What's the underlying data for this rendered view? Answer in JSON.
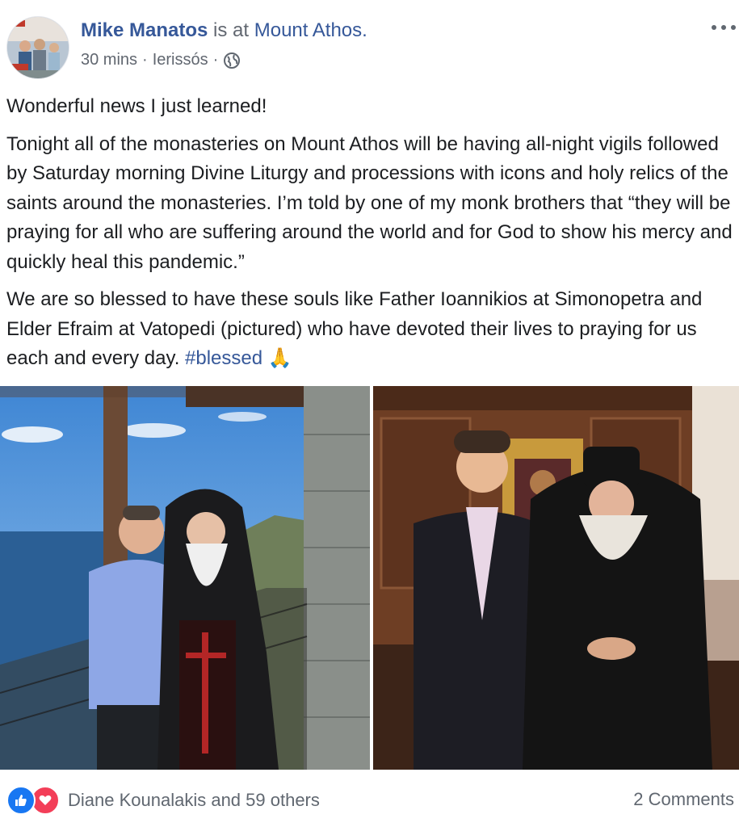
{
  "post": {
    "author": "Mike Manatos",
    "at_text": "is at",
    "location": "Mount Athos.",
    "time": "30 mins",
    "separator": "·",
    "place": "Ierissós",
    "privacy_icon": "globe-icon",
    "more_icon": "more-options-icon",
    "paragraphs": {
      "p1": "Wonderful news I just learned!",
      "p2": "Tonight all of the monasteries on Mount Athos will be having all-night vigils followed by Saturday morning Divine Liturgy and processions with icons and holy relics of the saints around the monasteries. I’m told by one of my monk brothers that “they will be praying for all who are suffering around the world and for God to show his mercy and quickly heal this pandemic.”",
      "p3_text": "We are so blessed to have these souls like Father Ioannikios at Simonopetra and Elder Efraim at Vatopedi (pictured) who have devoted their lives to praying for us each and every day.",
      "hashtag": "#blessed",
      "emoji": "🙏"
    },
    "photos": [
      {
        "icon": "photo-balcony-monk"
      },
      {
        "icon": "photo-elder-icon-room"
      }
    ]
  },
  "footer": {
    "reactions": [
      "like-icon",
      "love-icon"
    ],
    "reaction_names": "Diane Kounalakis and 59 others",
    "comments": "2 Comments"
  },
  "colors": {
    "link": "#365899",
    "meta": "#616770",
    "like": "#1877f2",
    "love": "#f33e58"
  }
}
